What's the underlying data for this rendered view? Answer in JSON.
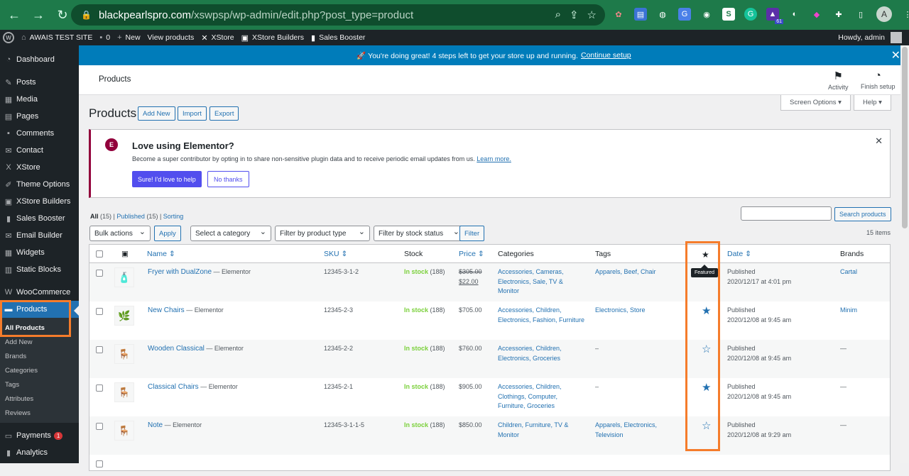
{
  "browser": {
    "url_host": "blackpearlspro.com",
    "url_path": "/xswpsp/wp-admin/edit.php?post_type=product",
    "ext_badge": "61",
    "profile_initial": "A"
  },
  "adminbar": {
    "site": "AWAIS TEST SITE",
    "comments": "0",
    "new": "New",
    "view": "View products",
    "xstore": "XStore",
    "builders": "XStore Builders",
    "booster": "Sales Booster",
    "howdy": "Howdy, admin"
  },
  "sidebar": {
    "items": [
      {
        "label": "Dashboard",
        "icon": "dashboard-icon"
      },
      {
        "label": "Posts",
        "icon": "pin-icon"
      },
      {
        "label": "Media",
        "icon": "media-icon"
      },
      {
        "label": "Pages",
        "icon": "page-icon"
      },
      {
        "label": "Comments",
        "icon": "comment-icon"
      },
      {
        "label": "Contact",
        "icon": "mail-icon"
      },
      {
        "label": "XStore",
        "icon": "xstore-icon"
      },
      {
        "label": "Theme Options",
        "icon": "brush-icon"
      },
      {
        "label": "XStore Builders",
        "icon": "builder-icon"
      },
      {
        "label": "Sales Booster",
        "icon": "chart-icon"
      },
      {
        "label": "Email Builder",
        "icon": "email-icon"
      },
      {
        "label": "Widgets",
        "icon": "widgets-icon"
      },
      {
        "label": "Static Blocks",
        "icon": "blocks-icon"
      },
      {
        "label": "WooCommerce",
        "icon": "woo-icon"
      },
      {
        "label": "Products",
        "icon": "product-icon"
      }
    ],
    "submenu": [
      "All Products",
      "Add New",
      "Brands",
      "Categories",
      "Tags",
      "Attributes",
      "Reviews"
    ],
    "after": [
      {
        "label": "Payments",
        "badge": "1"
      },
      {
        "label": "Analytics"
      }
    ]
  },
  "notice": {
    "text": "🚀 You're doing great! 4 steps left to get your store up and running.",
    "link": "Continue setup"
  },
  "wc_header": {
    "title": "Products",
    "activity": "Activity",
    "finish": "Finish setup",
    "screen_options": "Screen Options ▾",
    "help": "Help ▾"
  },
  "page": {
    "title": "Products",
    "add_new": "Add New",
    "import": "Import",
    "export": "Export"
  },
  "elementor": {
    "title": "Love using Elementor?",
    "desc": "Become a super contributor by opting in to share non-sensitive plugin data and to receive periodic email updates from us.",
    "learn": "Learn more.",
    "yes": "Sure! I'd love to help",
    "no": "No thanks"
  },
  "filters": {
    "all": "All",
    "all_count": "(15)",
    "published": "Published",
    "pub_count": "(15)",
    "sorting": "Sorting",
    "bulk": "Bulk actions",
    "apply": "Apply",
    "category": "Select a category",
    "type": "Filter by product type",
    "stock": "Filter by stock status",
    "filter": "Filter",
    "search": "Search products",
    "items": "15 items"
  },
  "columns": {
    "name": "Name ⇕",
    "sku": "SKU ⇕",
    "stock": "Stock",
    "price": "Price ⇕",
    "categories": "Categories",
    "tags": "Tags",
    "date": "Date ⇕",
    "brands": "Brands",
    "featured_tip": "Featured"
  },
  "rows": [
    {
      "name": "Fryer with DualZone",
      "suffix": " — Elementor",
      "sku": "12345-3-1-2",
      "stock": "In stock",
      "qty": " (188)",
      "price_old": "$305.00",
      "price": "$22.00",
      "cats": [
        "Accessories, Cameras,",
        "Electronics, Sale, TV &",
        "Monitor"
      ],
      "tags": [
        "Apparels, Beef, Chair"
      ],
      "featured": false,
      "date": "Published",
      "date2": "2020/12/17 at 4:01 pm",
      "brand": "Cartal",
      "thumb": "🧴"
    },
    {
      "name": "New Chairs",
      "suffix": " — Elementor",
      "sku": "12345-2-3",
      "stock": "In stock",
      "qty": " (188)",
      "price_old": "",
      "price": "$705.00",
      "cats": [
        "Accessories, Children,",
        "Electronics, Fashion, Furniture"
      ],
      "tags": [
        "Electronics, Store"
      ],
      "featured": true,
      "date": "Published",
      "date2": "2020/12/08 at 9:45 am",
      "brand": "Minim",
      "thumb": "🌿"
    },
    {
      "name": "Wooden Classical",
      "suffix": " — Elementor",
      "sku": "12345-2-2",
      "stock": "In stock",
      "qty": " (188)",
      "price_old": "",
      "price": "$760.00",
      "cats": [
        "Accessories, Children,",
        "Electronics, Groceries"
      ],
      "tags": [
        "–"
      ],
      "featured": false,
      "date": "Published",
      "date2": "2020/12/08 at 9:45 am",
      "brand": "—",
      "thumb": "🪑"
    },
    {
      "name": "Classical Chairs",
      "suffix": " — Elementor",
      "sku": "12345-2-1",
      "stock": "In stock",
      "qty": " (188)",
      "price_old": "",
      "price": "$905.00",
      "cats": [
        "Accessories, Children,",
        "Clothings, Computer,",
        "Furniture, Groceries"
      ],
      "tags": [
        "–"
      ],
      "featured": true,
      "date": "Published",
      "date2": "2020/12/08 at 9:45 am",
      "brand": "—",
      "thumb": "🪑"
    },
    {
      "name": "Note",
      "suffix": " — Elementor",
      "sku": "12345-3-1-1-5",
      "stock": "In stock",
      "qty": " (188)",
      "price_old": "",
      "price": "$850.00",
      "cats": [
        "Children, Furniture, TV &",
        "Monitor"
      ],
      "tags": [
        "Apparels, Electronics,",
        "Television"
      ],
      "featured": false,
      "date": "Published",
      "date2": "2020/12/08 at 9:29 am",
      "brand": "—",
      "thumb": "🪑"
    }
  ]
}
